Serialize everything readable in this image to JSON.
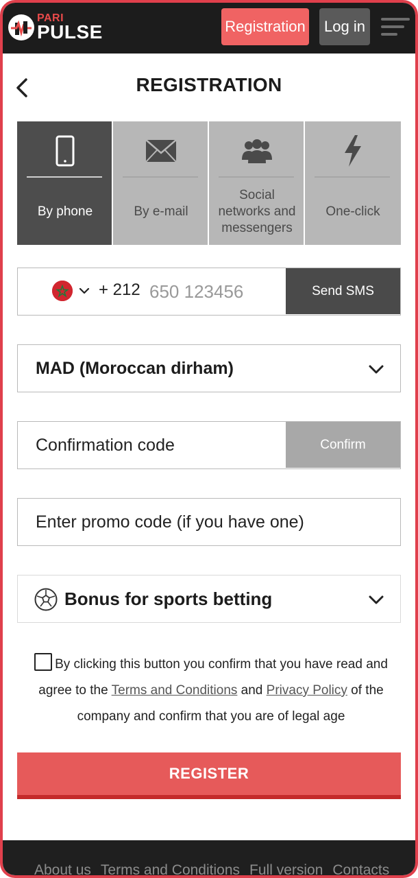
{
  "header": {
    "logo_top": "PARI",
    "logo_bottom": "PULSE",
    "registration_label": "Registration",
    "login_label": "Log in"
  },
  "page": {
    "title": "REGISTRATION"
  },
  "tabs": [
    {
      "label": "By phone",
      "icon": "phone-icon",
      "active": true
    },
    {
      "label": "By e-mail",
      "icon": "envelope-icon",
      "active": false
    },
    {
      "label": "Social networks and messengers",
      "icon": "people-icon",
      "active": false
    },
    {
      "label": "One-click",
      "icon": "lightning-icon",
      "active": false
    }
  ],
  "phone": {
    "country_flag": "morocco-flag-icon",
    "dial_code": "+ 212",
    "placeholder": "650 123456",
    "send_sms_label": "Send SMS"
  },
  "currency": {
    "selected": "MAD (Moroccan dirham)"
  },
  "confirmation": {
    "placeholder": "Confirmation code",
    "confirm_label": "Confirm"
  },
  "promo": {
    "placeholder": "Enter promo code (if you have one)"
  },
  "bonus": {
    "selected": "Bonus for sports betting",
    "icon": "soccer-ball-icon"
  },
  "consent": {
    "text_before": "By clicking this button you confirm that you have read and agree to the ",
    "terms_link": "Terms and Conditions",
    "and": " and ",
    "privacy_link": "Privacy Policy",
    "text_after": " of the company and confirm that you are of legal age",
    "checked": false
  },
  "register": {
    "label": "REGISTER"
  },
  "footer": {
    "links": [
      "About us",
      "Terms and Conditions",
      "Full version",
      "Contacts"
    ]
  },
  "colors": {
    "accent": "#f06363",
    "brand_red": "#e0404c",
    "dark": "#1c1c1c",
    "active_tab": "#4d4d4d",
    "inactive_tab": "#b7b7b7"
  }
}
